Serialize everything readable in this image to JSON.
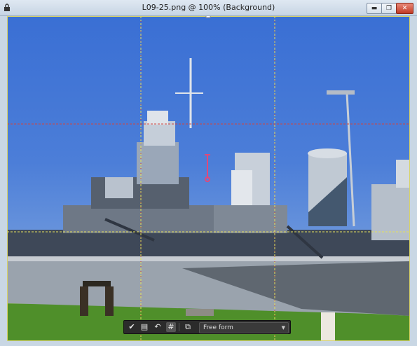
{
  "window": {
    "title": "L09-25.png @ 100% (Background)",
    "buttons": {
      "minimize": "▬",
      "maximize": "❐",
      "close": "✕"
    }
  },
  "toolbar": {
    "commit_icon": "check-icon",
    "straighten_icon": "straighten-icon",
    "rotate_icon": "rotate-icon",
    "grid_icon": "grid-icon",
    "constrain_icon": "constrain-icon",
    "constraint_value": "Free form"
  },
  "colors": {
    "sky": "#4c7ed8",
    "hull": "#9aa3ad",
    "grass": "#4f8f2a",
    "guide_red": "#d0453f",
    "guide_yellow": "#e6e05a",
    "toolbar": "#2b2b2b"
  }
}
